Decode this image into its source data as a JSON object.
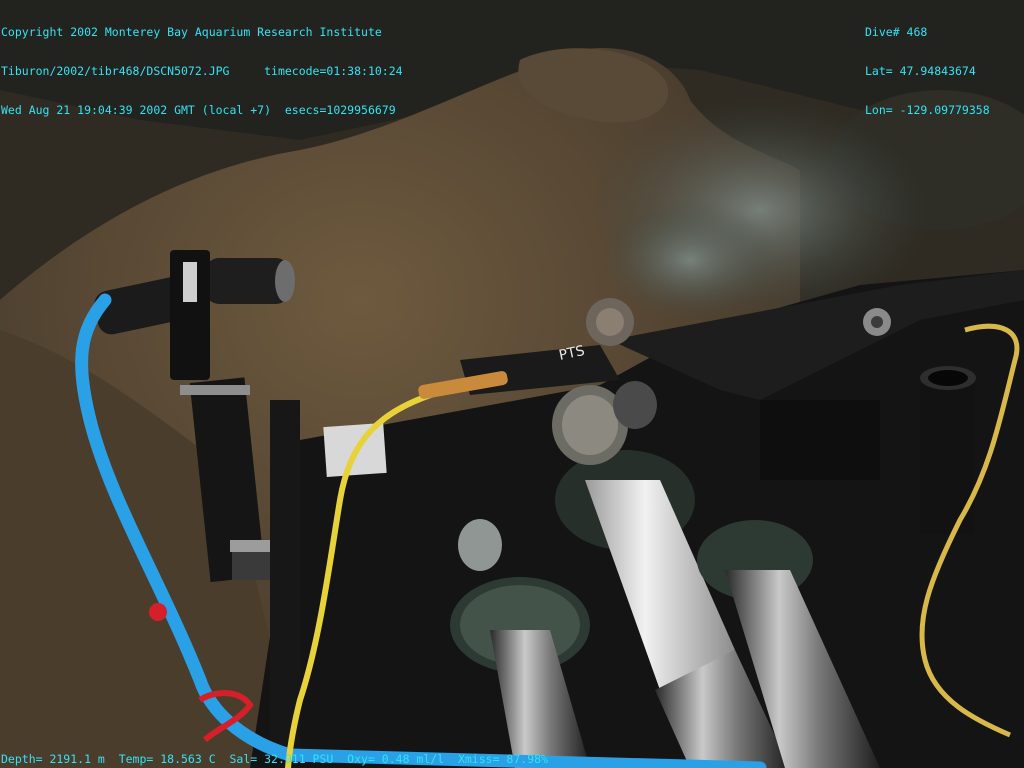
{
  "overlay": {
    "top_left": [
      "Copyright 2002 Monterey Bay Aquarium Research Institute",
      "Tiburon/2002/tibr468/DSCN5072.JPG     timecode=01:38:10:24",
      "Wed Aug 21 19:04:39 2002 GMT (local +7)  esecs=1029956679"
    ],
    "top_right": [
      "Dive# 468",
      "Lat= 47.94843674",
      "Lon= -129.09779358"
    ],
    "bottom_left": "Depth= 2191.1 m  Temp= 18.563 C  Sal= 32.011 PSU  Oxy= 0.48 ml/l  Xmiss= 87.98%"
  },
  "labels": {
    "sample_tag": "PTS"
  },
  "colors": {
    "overlay_text": "#31e3f5",
    "cable_blue": "#2aa0e6",
    "cable_yellow": "#e8d23a",
    "rope_yellow": "#d9b84a",
    "sediment": "#5b4a33",
    "frame_black": "#141414"
  }
}
